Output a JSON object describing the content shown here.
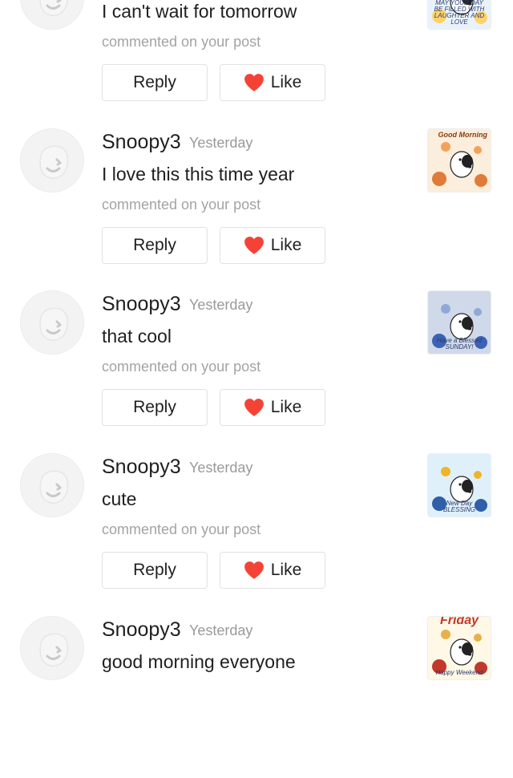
{
  "comments": [
    {
      "username": "",
      "time": "",
      "text": "I can't wait for tomorrow",
      "meta": "commented on your post",
      "reply_label": "Reply",
      "like_label": "Like",
      "thumb_caption": "MAY YOUR DAY BE FILLED WITH LAUGHTER AND LOVE",
      "thumb_top": "",
      "thumb_colors": [
        "#e9f2fb",
        "#ffd36b",
        "#f08080"
      ]
    },
    {
      "username": "Snoopy3",
      "time": "Yesterday",
      "text": "I love this this time year",
      "meta": "commented on your post",
      "reply_label": "Reply",
      "like_label": "Like",
      "thumb_caption": "",
      "thumb_top": "Good Morning",
      "thumb_colors": [
        "#fbeedd",
        "#e07b39",
        "#f4a259"
      ]
    },
    {
      "username": "Snoopy3",
      "time": "Yesterday",
      "text": "that cool",
      "meta": "commented on your post",
      "reply_label": "Reply",
      "like_label": "Like",
      "thumb_caption": "Have a Blessed SUNDAY!",
      "thumb_top": "",
      "thumb_colors": [
        "#cfd9ea",
        "#3b62b5",
        "#8fa8d8"
      ]
    },
    {
      "username": "Snoopy3",
      "time": "Yesterday",
      "text": "cute",
      "meta": "commented on your post",
      "reply_label": "Reply",
      "like_label": "Like",
      "thumb_caption": "New Day BLESSING",
      "thumb_top": "",
      "thumb_colors": [
        "#dff0fb",
        "#2f5fa8",
        "#f0b429"
      ]
    },
    {
      "username": "Snoopy3",
      "time": "Yesterday",
      "text": "good morning everyone",
      "meta": "",
      "reply_label": "",
      "like_label": "",
      "thumb_caption": "Happy Weekend",
      "thumb_top": "Friday",
      "thumb_colors": [
        "#fff8e6",
        "#c0392b",
        "#e8b04a"
      ]
    }
  ],
  "colors": {
    "heart": "#f44336",
    "button_border": "#e2e2e2",
    "muted_text": "#a3a3a3",
    "timestamp": "#9a9a9a"
  },
  "icons": {
    "avatar": "default-avatar-face-icon",
    "like": "heart-icon"
  }
}
